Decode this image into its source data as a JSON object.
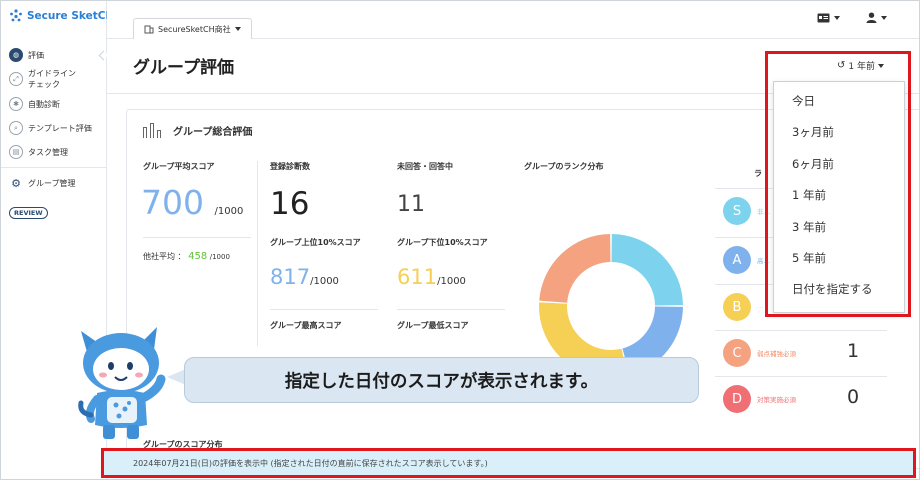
{
  "app": {
    "logo_text": "Secure SketCH"
  },
  "sidebar": {
    "items": [
      {
        "label": "評価"
      },
      {
        "label": "ガイドライン\nチェック"
      },
      {
        "label": "自動診断"
      },
      {
        "label": "テンプレート評価"
      },
      {
        "label": "タスク管理"
      },
      {
        "label": "グループ管理"
      }
    ],
    "review_badge": "REVIEW"
  },
  "topbar": {
    "company_tab": "SecureSketCH商社",
    "right_icons": [
      "id-card-icon",
      "user-icon"
    ]
  },
  "page": {
    "title": "グループ評価",
    "period_label": "1 年前"
  },
  "card": {
    "title": "グループ総合評価",
    "avg_score_label": "グループ平均スコア",
    "avg_score": "700",
    "score_unit": "/1000",
    "other_avg_label": "他社平均 ：",
    "other_avg_value": "458",
    "other_avg_unit": "/1000",
    "registered_label": "登録診断数",
    "registered_value": "16",
    "unanswered_label": "未回答・回答中",
    "unanswered_value": "11",
    "top10_label": "グループ上位10%スコア",
    "top10_value": "817",
    "top10_unit": "/1000",
    "bottom10_label": "グループ下位10%スコア",
    "bottom10_value": "611",
    "bottom10_unit": "/1000",
    "max_label": "グループ最高スコア",
    "min_label": "グループ最低スコア",
    "rank_dist_label": "グループのランク分布",
    "rank_header": "ラ",
    "score_dist_label": "グループのスコア分布"
  },
  "ranks": [
    {
      "letter": "S",
      "text": "非…",
      "count": "",
      "color": "#7dd3ee",
      "text_color": "#7dd3ee"
    },
    {
      "letter": "A",
      "text": "高…",
      "count": "",
      "color": "#7fb2ec",
      "text_color": "#7fb2ec"
    },
    {
      "letter": "B",
      "text": "…",
      "count": "",
      "color": "#f6cf55",
      "text_color": "#f6cf55"
    },
    {
      "letter": "C",
      "text": "弱点補強必須",
      "count": "1",
      "color": "#f4a27f",
      "text_color": "#f08a63"
    },
    {
      "letter": "D",
      "text": "対策実施必須",
      "count": "0",
      "color": "#ef6f74",
      "text_color": "#ef6f74"
    }
  ],
  "donut": {
    "segments": [
      {
        "rank": "S",
        "value": 25,
        "color": "#7dd3ee"
      },
      {
        "rank": "A",
        "value": 21,
        "color": "#7fb2ec"
      },
      {
        "rank": "B",
        "value": 30,
        "color": "#f6cf55"
      },
      {
        "rank": "C",
        "value": 24,
        "color": "#f4a27f"
      }
    ]
  },
  "dropdown": {
    "options": [
      "今日",
      "3ヶ月前",
      "6ヶ月前",
      "1 年前",
      "3 年前",
      "5 年前",
      "日付を指定する"
    ]
  },
  "callout": {
    "text": "指定した日付のスコアが表示されます。"
  },
  "banner": {
    "text": "2024年07月21日(日)の評価を表示中 (指定された日付の直前に保存されたスコア表示しています。)"
  },
  "colors": {
    "accent": "#2a7fd4",
    "highlight": "#e0161d",
    "banner_bg": "#d9f0fb",
    "score_blue": "#7fb2ec",
    "score_orange": "#f6cf55",
    "other_green": "#63c23a"
  }
}
